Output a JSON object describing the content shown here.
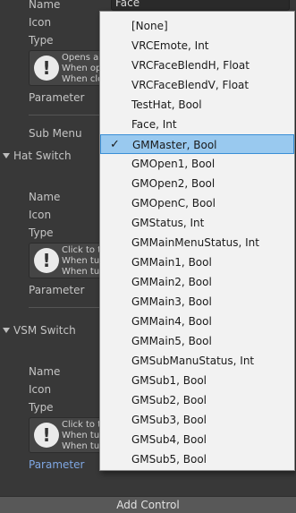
{
  "header": {
    "name_label": "Name",
    "name_value": "Face",
    "icon_label": "Icon",
    "type_label": "Type",
    "help_lines": [
      "Opens ar",
      "When ope",
      "When clo"
    ],
    "parameter_label": "Parameter",
    "submenu_label": "Sub Menu"
  },
  "sections": [
    {
      "title": "Hat Switch",
      "name_label": "Name",
      "icon_label": "Icon",
      "type_label": "Type",
      "help_lines": [
        "Click to t",
        "When tur",
        "When tur"
      ],
      "parameter_label": "Parameter"
    },
    {
      "title": "VSM Switch",
      "name_label": "Name",
      "icon_label": "Icon",
      "type_label": "Type",
      "help_lines": [
        "Click to t",
        "When tur",
        "When tur"
      ],
      "parameter_label": "Parameter"
    }
  ],
  "add_button_label": "Add Control",
  "dropdown": {
    "selected_index": 6,
    "check_glyph": "✓",
    "items": [
      "[None]",
      "VRCEmote, Int",
      "VRCFaceBlendH, Float",
      "VRCFaceBlendV, Float",
      "TestHat, Bool",
      "Face, Int",
      "GMMaster, Bool",
      "GMOpen1, Bool",
      "GMOpen2, Bool",
      "GMOpenC, Bool",
      "GMStatus, Int",
      "GMMainMenuStatus, Int",
      "GMMain1, Bool",
      "GMMain2, Bool",
      "GMMain3, Bool",
      "GMMain4, Bool",
      "GMMain5, Bool",
      "GMSubManuStatus, Int",
      "GMSub1, Bool",
      "GMSub2, Bool",
      "GMSub3, Bool",
      "GMSub4, Bool",
      "GMSub5, Bool"
    ]
  }
}
